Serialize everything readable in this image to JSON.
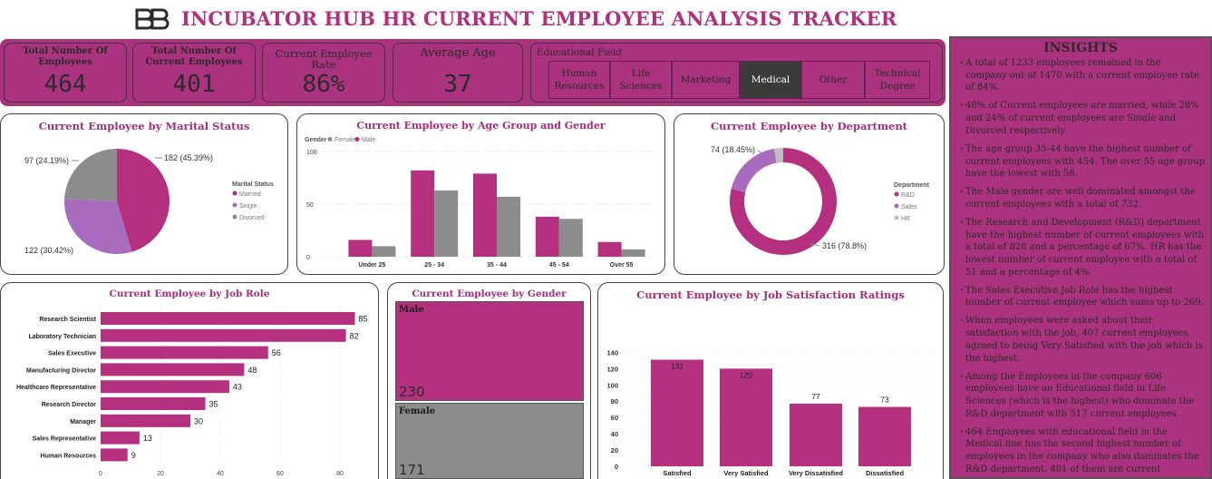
{
  "header": {
    "title": "INCUBATOR HUB HR CURRENT EMPLOYEE ANALYSIS TRACKER",
    "logo_icon": "bb-logo-icon"
  },
  "kpis": [
    {
      "label": "Total Number Of Employees",
      "value": "464"
    },
    {
      "label": "Total Number Of Current Employees",
      "value": "401"
    },
    {
      "label": "Current Employee Rate",
      "value": "86%"
    },
    {
      "label": "Average Age",
      "value": "37"
    }
  ],
  "education_filter": {
    "label": "Educational Field",
    "options": [
      "Human Resources",
      "Life Sciences",
      "Marketing",
      "Medical",
      "Other",
      "Technical Degree"
    ],
    "selected": "Medical"
  },
  "colors": {
    "accent": "#ab327e",
    "magenta": "#b5307f",
    "grey": "#8c8c8c",
    "lilac": "#a86bbd",
    "light_grey": "#bdbdbd"
  },
  "chart_data": [
    {
      "id": "marital",
      "type": "pie",
      "title": "Current Employee by Marital Status",
      "legend_title": "Marital Status",
      "slices": [
        {
          "name": "Married",
          "value": 182,
          "label": "182 (45.39%)",
          "color": "#b5307f"
        },
        {
          "name": "Single",
          "value": 122,
          "label": "122 (30.42%)",
          "color": "#a86bbd"
        },
        {
          "name": "Divorced",
          "value": 97,
          "label": "97 (24.19%)",
          "color": "#8c8c8c"
        }
      ]
    },
    {
      "id": "agegender",
      "type": "bar",
      "title": "Current Employee by Age Group and Gender",
      "legend_title": "Gender",
      "categories": [
        "Under 25",
        "25 - 34",
        "35 - 44",
        "45 - 54",
        "Over 55"
      ],
      "series": [
        {
          "name": "Female",
          "values": [
            10,
            63,
            57,
            36,
            7
          ],
          "color": "#8c8c8c"
        },
        {
          "name": "Male",
          "values": [
            16,
            82,
            79,
            38,
            14
          ],
          "color": "#b5307f"
        }
      ],
      "yticks": [
        0,
        50,
        100
      ],
      "ylim": [
        0,
        100
      ]
    },
    {
      "id": "department",
      "type": "pie",
      "title": "Current Employee by Department",
      "legend_title": "Department",
      "slices": [
        {
          "name": "R&D",
          "value": 316,
          "label": "316 (78.8%)",
          "color": "#b5307f"
        },
        {
          "name": "Sales",
          "value": 74,
          "label": "74 (18.45%)",
          "color": "#a86bbd"
        },
        {
          "name": "HR",
          "value": 11,
          "label": "",
          "color": "#bdbdbd"
        }
      ]
    },
    {
      "id": "jobrole",
      "type": "bar",
      "orientation": "horizontal",
      "title": "Current Employee by Job Role",
      "categories": [
        "Research Scientist",
        "Laboratory Technician",
        "Sales Executive",
        "Manufacturing Director",
        "Healthcare Representative",
        "Research Director",
        "Manager",
        "Sales Representative",
        "Human Resources"
      ],
      "values": [
        85,
        82,
        56,
        48,
        43,
        35,
        30,
        13,
        9
      ],
      "xticks": [
        0,
        20,
        40,
        60,
        80
      ],
      "xlim": [
        0,
        85
      ]
    },
    {
      "id": "gender",
      "type": "treemap",
      "title": "Current Employee by Gender",
      "items": [
        {
          "name": "Male",
          "value": 230,
          "color": "#b5307f"
        },
        {
          "name": "Female",
          "value": 171,
          "color": "#8c8c8c"
        }
      ]
    },
    {
      "id": "satisfaction",
      "type": "bar",
      "title": "Current Employee by Job Satisfaction Ratings",
      "categories": [
        "Satisfied",
        "Very Satisfied",
        "Very Dissatisfied",
        "Dissatisfied"
      ],
      "values": [
        131,
        120,
        77,
        73
      ],
      "yticks": [
        0,
        20,
        40,
        60,
        80,
        100,
        120,
        140
      ],
      "ylim": [
        0,
        140
      ]
    }
  ],
  "insights": {
    "title": "INSIGHTS",
    "items": [
      "A total of 1233  employees remained in the company out of  1470 with a current employee rate of 84%.",
      "48% of Current employees are married, while 28% and 24% of current employees are Single and Divorced respectively",
      "The age group 35-44 have the highest number of current employees with 454. The over 55 age group have the lowest with 58.",
      "The Male gender are well dominated amongst the current employees with a total of 732.",
      " The Research and Development (R&D) department have the highest number of current employees with a total of 828 and a percentage of 67%. HR has the lowest number of current employee with a total of 51 and a percentage of  4%.",
      " The Sales Executive Job Role has the highest number of current employee which sums up to 269.",
      " When employees were asked about their satisfaction with the job, 407 current employees agreed to being Very Satisfied with the job which is the highest.",
      " Among the Employees in the company 606 employees have an Educational field in Life Sciences (which is the highest) who dominate the R&D department with 517 current employees.",
      " 464 Employees with educational field in the Medical line has the second highest number of employees in the company who also dominates the R&D department. 401 of them are current employees."
    ]
  }
}
